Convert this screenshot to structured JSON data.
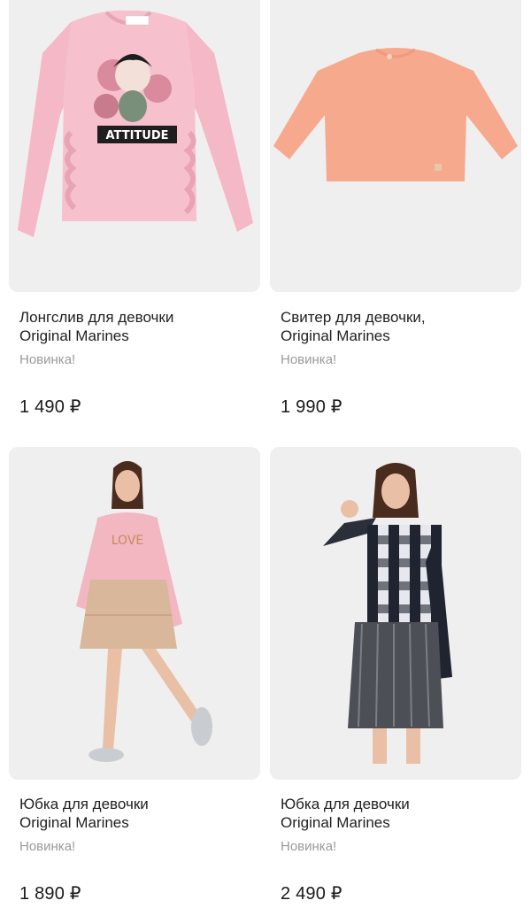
{
  "products": [
    {
      "title_line1": "Лонгслив для девочки",
      "title_line2": "Original Marines",
      "badge": "Новинка!",
      "price": "1 490 ₽",
      "print_text": "ATTITUDE"
    },
    {
      "title_line1": "Свитер для девочки,",
      "title_line2": "Original Marines",
      "badge": "Новинка!",
      "price": "1 990 ₽"
    },
    {
      "title_line1": "Юбка для девочки",
      "title_line2": "Original Marines",
      "badge": "Новинка!",
      "price": "1 890 ₽",
      "print_text": "LOVE"
    },
    {
      "title_line1": "Юбка для девочки",
      "title_line2": "Original Marines",
      "badge": "Новинка!",
      "price": "2 490 ₽"
    }
  ]
}
